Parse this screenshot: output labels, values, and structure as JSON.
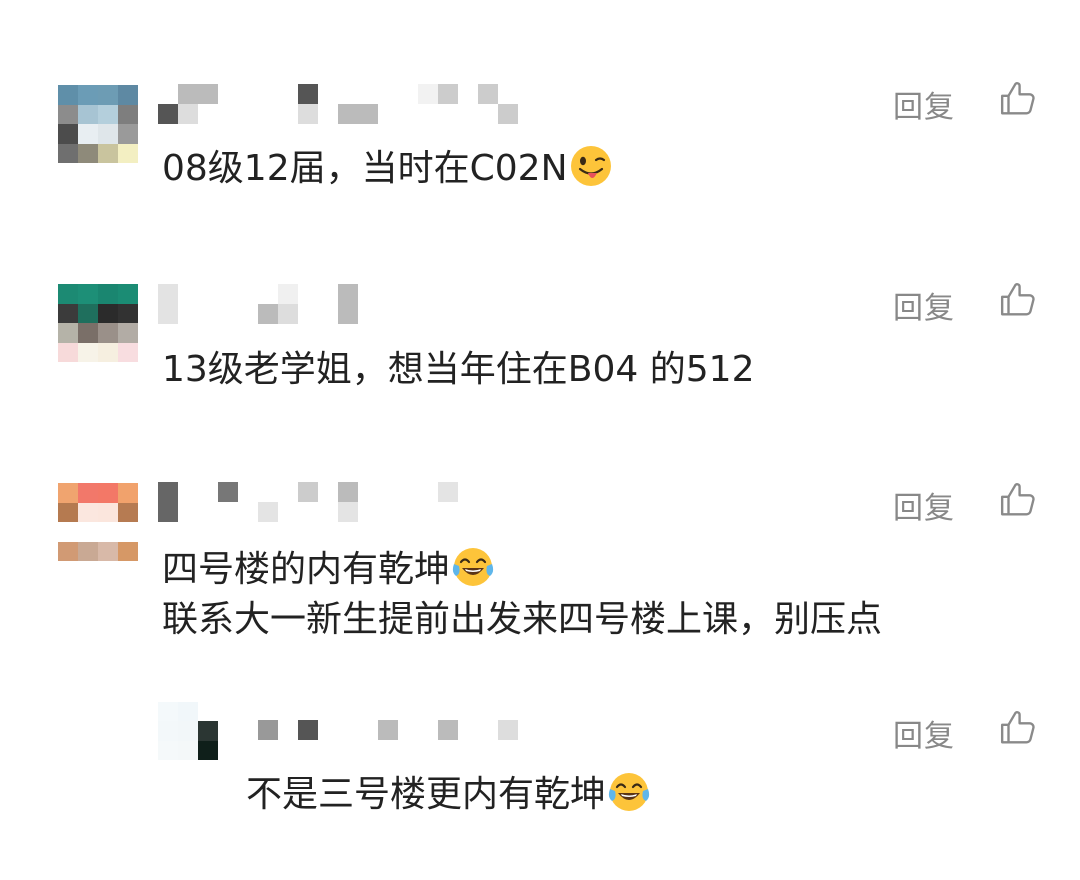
{
  "comments": [
    {
      "reply_label": "回复",
      "text": "08级12届，当时在C02N",
      "emoji": "winking-tongue-emoji"
    },
    {
      "reply_label": "回复",
      "text": "13级老学姐，想当年住在B04  的512"
    },
    {
      "reply_label": "回复",
      "text_line1": "四号楼的内有乾坤",
      "emoji": "tears-of-joy-emoji",
      "text_line2": "联系大一新生提前出发来四号楼上课，别压点"
    },
    {
      "reply_label": "回复",
      "text": "不是三号楼更内有乾坤",
      "emoji": "tears-of-joy-emoji"
    }
  ],
  "colors": {
    "text": "#222222",
    "muted": "#888888",
    "emoji": "#FDC43A"
  }
}
